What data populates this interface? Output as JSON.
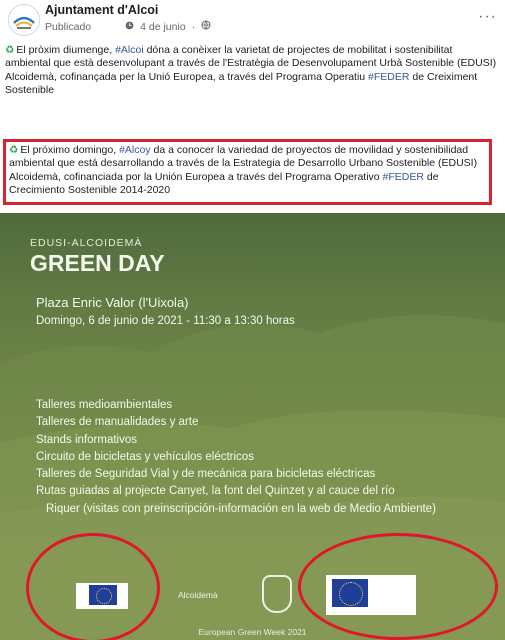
{
  "post": {
    "page_name": "Ajuntament d'Alcoi",
    "status": "Publicado",
    "date": "4 de junio",
    "more_label": "···",
    "icons": {
      "audience": "globe-icon",
      "more": "more-options-icon",
      "avatar": "ajuntament-logo"
    }
  },
  "caption_ca": {
    "emoji": "♻",
    "text1": "El pròxim diumenge, ",
    "hashtag1": "#Alcoi",
    "text2": " dóna a conèixer la varietat de projectes de mobilitat i sostenibilitat ambiental que està desenvolupant a través de l'Estratègia de Desenvolupament Urbà Sostenible (EDUSI) Alcoidemà, cofinançada per la Unió Europea, a través del Programa Operatiu ",
    "hashtag2": "#FEDER",
    "text3": " de Creiximent Sostenible"
  },
  "caption_es": {
    "emoji": "♻",
    "text1": "El próximo domingo, ",
    "hashtag1": "#Alcoy",
    "text2": " da a conocer la variedad de proyectos de movilidad y sostenibilidad ambiental que está desarrollando a través de la Estrategia de Desarrollo Urbano Sostenible (EDUSI) Alcoidemà, cofinanciada por la Unión Europea a través del Programa Operativo ",
    "hashtag2": "#FEDER",
    "text3": " de Crecimiento Sostenible 2014-2020"
  },
  "poster": {
    "tag": "EDUSI-ALCOIDEMÀ",
    "title": "GREEN DAY",
    "place": "Plaza Enric Valor (l'Uixola)",
    "datetime": "Domingo, 6 de junio de 2021 - 11:30 a 13:30 horas",
    "activities": [
      "Talleres medioambientales",
      "Talleres de manualidades y arte",
      "Stands informativos",
      "Circuito de bicicletas y vehículos eléctricos",
      "Talleres de Seguridad Vial y de mecánica para bicicletas eléctricas",
      "Rutas guiadas al projecte Canyet, la font del Quinzet y al cauce del río",
      "Riquer (visitas con preinscripción-información en la web de Medio Ambiente)"
    ],
    "logo_alcoidema": "Alcoidemà",
    "footer": "European Green Week 2021"
  },
  "colors": {
    "highlight_red": "#d9232e",
    "link_blue": "#385898",
    "poster_green": "#6e8447"
  }
}
